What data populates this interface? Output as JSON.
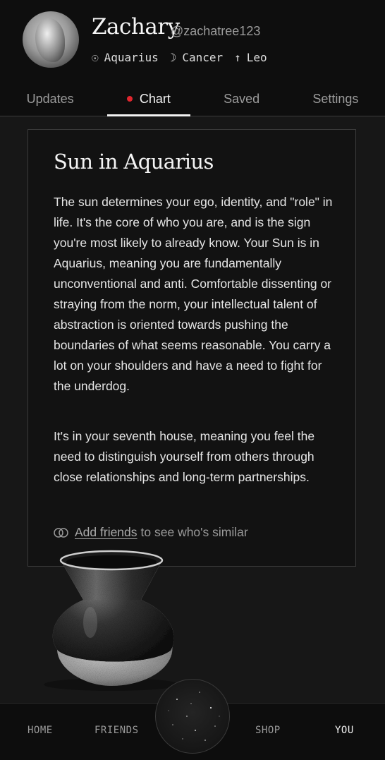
{
  "profile": {
    "name": "Zachary",
    "handle": "@zachatree123",
    "sun_glyph": "☉",
    "sun_sign": "Aquarius",
    "moon_glyph": "☽",
    "moon_sign": "Cancer",
    "rising_glyph": "↑",
    "rising_sign": "Leo"
  },
  "tabs": [
    {
      "label": "Updates",
      "active": false
    },
    {
      "label": "Chart",
      "active": true
    },
    {
      "label": "Saved",
      "active": false
    },
    {
      "label": "Settings",
      "active": false
    }
  ],
  "card": {
    "title": "Sun in Aquarius",
    "paragraph1": "The sun determines your ego, identity, and \"role\" in life. It's the core of who you are, and is the sign you're most likely to already know. Your Sun is in Aquarius, meaning you are fundamentally unconventional and anti. Comfortable dissenting or straying from the norm, your intellectual talent of abstraction is oriented towards pushing the boundaries of what seems reasonable. You carry a lot on your shoulders and have a need to fight for the underdog.",
    "paragraph2": "It's in your seventh house, meaning you feel the need to distinguish yourself from others through close relationships and long-term partnerships.",
    "friends_link": "Add friends",
    "friends_suffix": "to see who's similar",
    "friends_icon": "overlapping-circles-icon"
  },
  "bottom_nav": {
    "home": "HOME",
    "friends": "FRIENDS",
    "shop": "SHOP",
    "you": "YOU",
    "active": "YOU"
  },
  "colors": {
    "background": "#171717",
    "header": "#0e0e0e",
    "accent_dot": "#e0262e",
    "text": "#e8e8e8",
    "muted": "#9b9b9b"
  }
}
